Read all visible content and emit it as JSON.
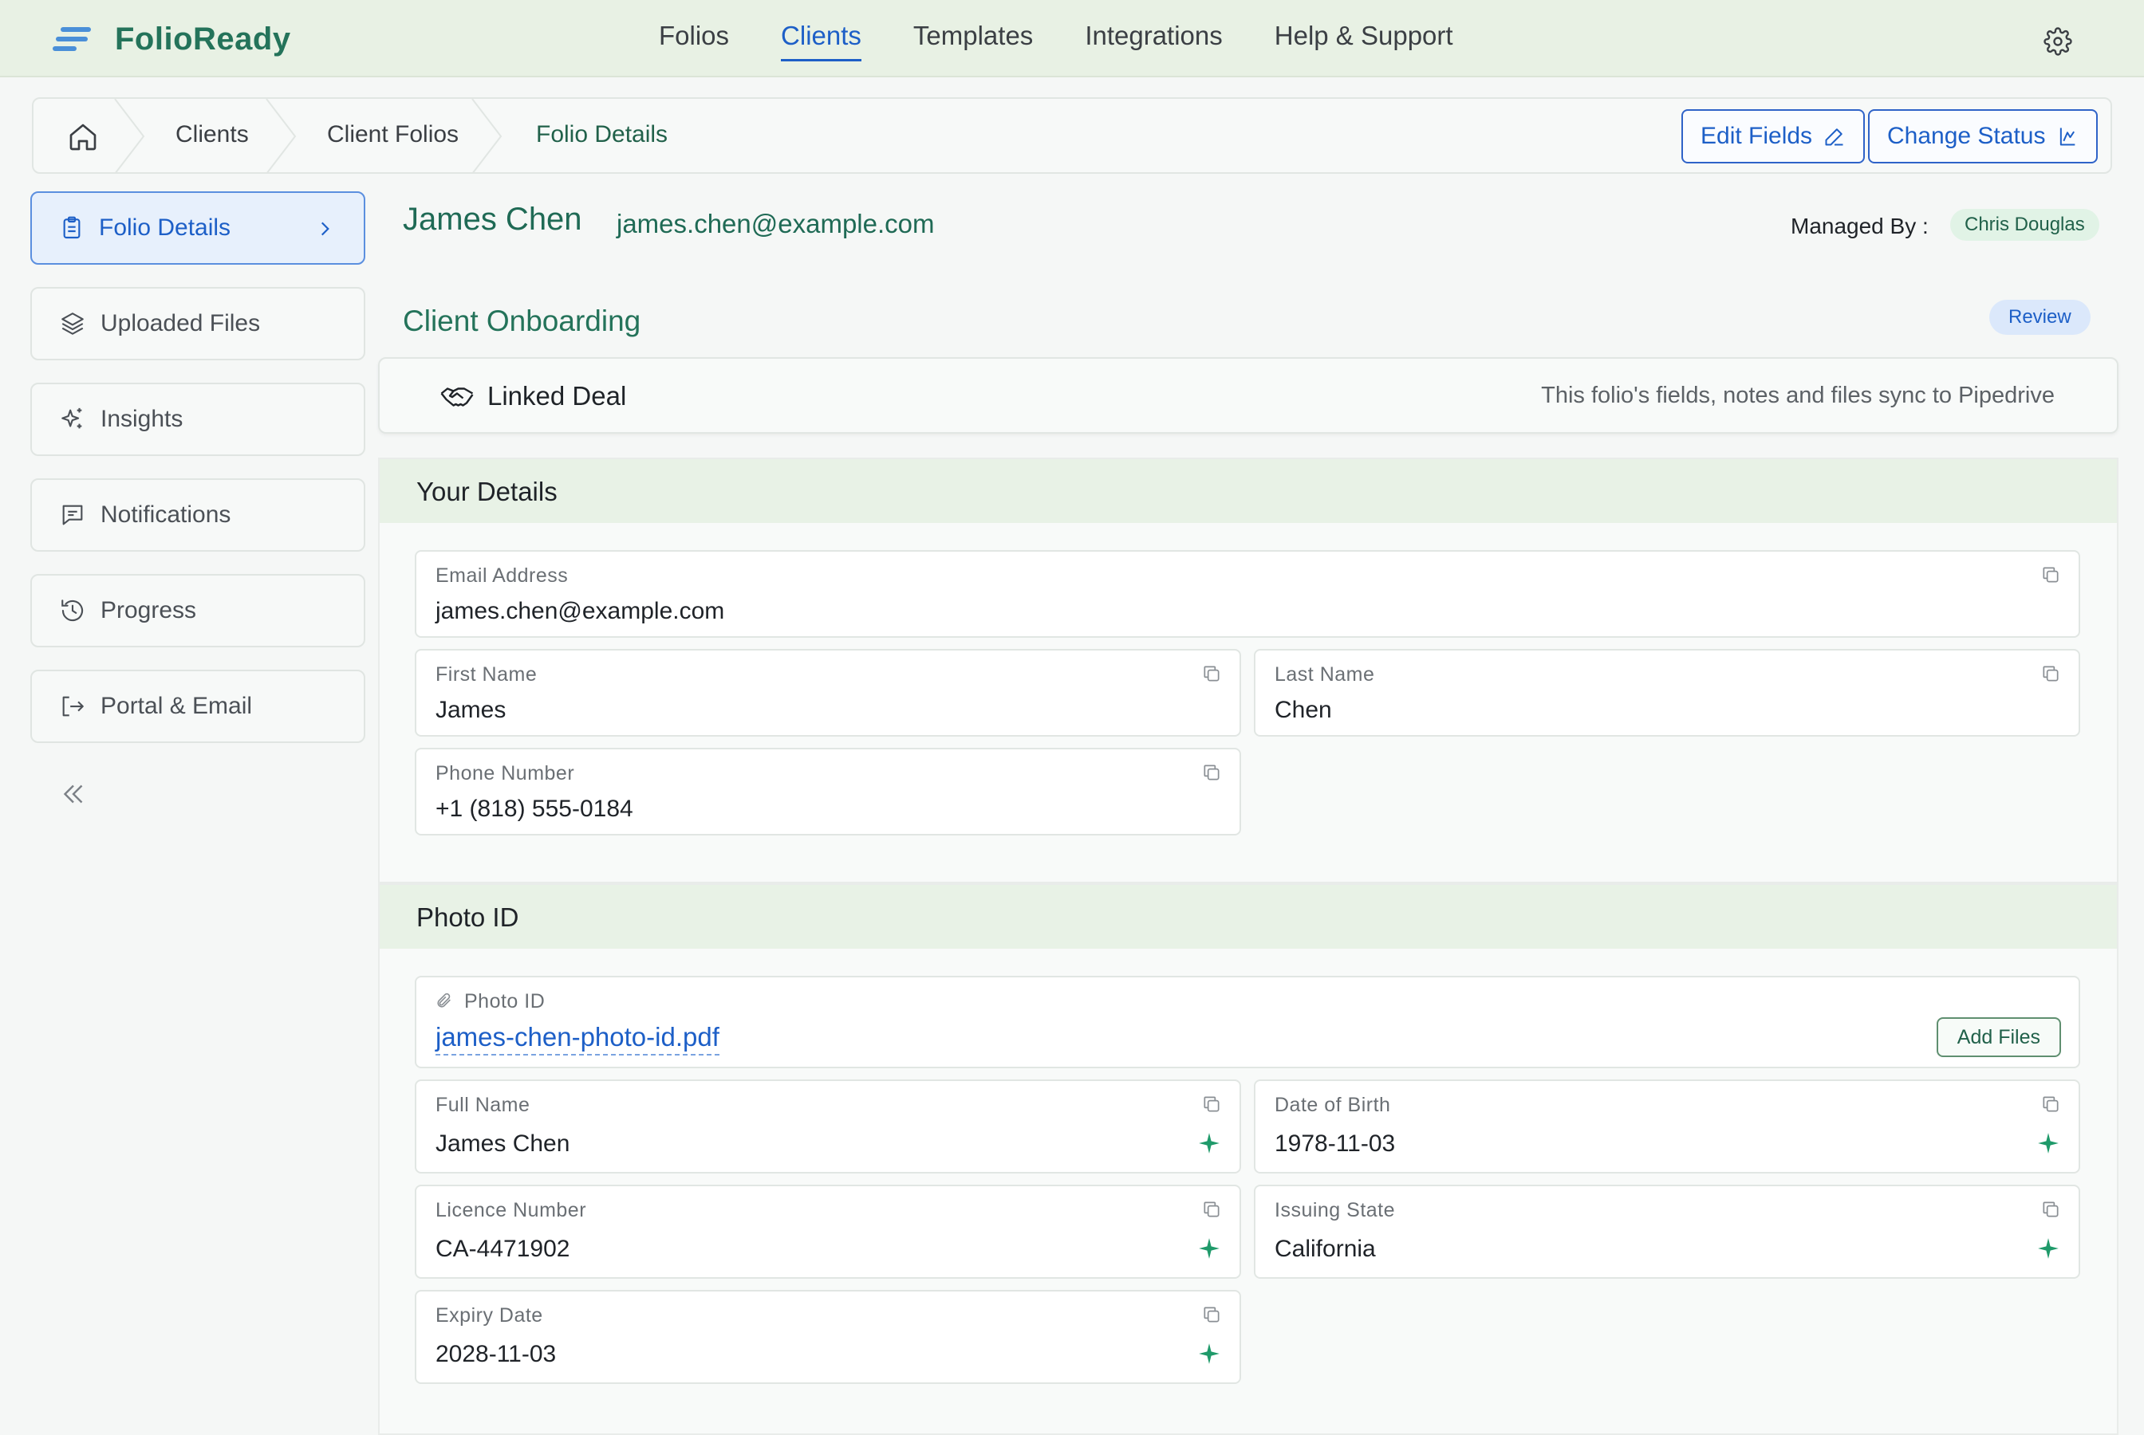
{
  "app": {
    "name": "FolioReady"
  },
  "nav": {
    "items": [
      "Folios",
      "Clients",
      "Templates",
      "Integrations",
      "Help & Support"
    ],
    "active": "Clients"
  },
  "breadcrumb": {
    "items": [
      "Clients",
      "Client Folios",
      "Folio Details"
    ]
  },
  "actions": {
    "edit_fields": "Edit Fields",
    "change_status": "Change Status"
  },
  "sidebar": {
    "items": [
      {
        "label": "Folio Details",
        "icon": "clipboard-icon",
        "active": true
      },
      {
        "label": "Uploaded Files",
        "icon": "layers-icon"
      },
      {
        "label": "Insights",
        "icon": "sparkles-icon"
      },
      {
        "label": "Notifications",
        "icon": "message-icon"
      },
      {
        "label": "Progress",
        "icon": "history-icon"
      },
      {
        "label": "Portal & Email",
        "icon": "logout-icon"
      }
    ]
  },
  "client": {
    "name": "James Chen",
    "email": "james.chen@example.com",
    "managed_by_label": "Managed By :",
    "managed_by": "Chris Douglas"
  },
  "section": {
    "title": "Client Onboarding",
    "status": "Review"
  },
  "linked_deal": {
    "title": "Linked Deal",
    "note": "This folio's fields, notes and files sync to Pipedrive"
  },
  "your_details": {
    "title": "Your Details",
    "email": {
      "label": "Email Address",
      "value": "james.chen@example.com"
    },
    "first_name": {
      "label": "First Name",
      "value": "James"
    },
    "last_name": {
      "label": "Last Name",
      "value": "Chen"
    },
    "phone": {
      "label": "Phone Number",
      "value": "+1 (818) 555-0184"
    }
  },
  "photo_id": {
    "title": "Photo ID",
    "file": {
      "label": "Photo ID",
      "filename": "james-chen-photo-id.pdf",
      "add_label": "Add Files"
    },
    "full_name": {
      "label": "Full Name",
      "value": "James Chen"
    },
    "dob": {
      "label": "Date of Birth",
      "value": "1978-11-03"
    },
    "licence": {
      "label": "Licence Number",
      "value": "CA-4471902"
    },
    "state": {
      "label": "Issuing State",
      "value": "California"
    },
    "expiry": {
      "label": "Expiry Date",
      "value": "2028-11-03"
    }
  },
  "colors": {
    "accent": "#1d5fc7",
    "brand": "#24735a",
    "header_bg": "#e8f1e4",
    "ai_spark": "#1f9a6a"
  }
}
